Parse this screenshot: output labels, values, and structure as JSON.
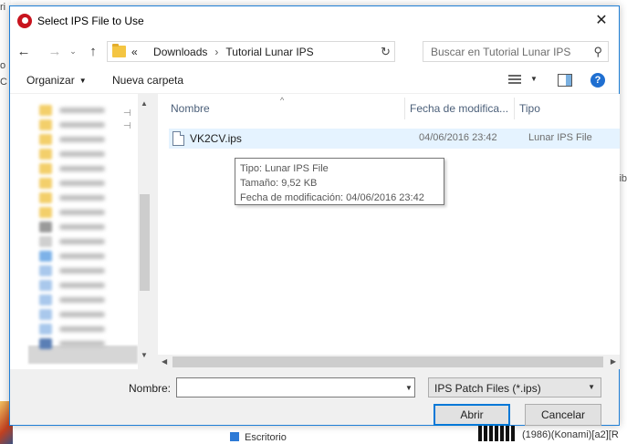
{
  "dialog": {
    "title": "Select IPS File to Use",
    "close_glyph": "✕"
  },
  "nav": {
    "back_glyph": "←",
    "forward_glyph": "→",
    "recent_glyph": "⌄",
    "up_glyph": "↑",
    "breadcrumb_overflow": "«",
    "breadcrumb": [
      "Downloads",
      "Tutorial Lunar IPS"
    ],
    "breadcrumb_separator": "›",
    "dropdown_glyph": "⌄",
    "refresh_glyph": "↻",
    "search_placeholder": "Buscar en Tutorial Lunar IPS",
    "search_glyph": "⚲"
  },
  "toolbar": {
    "organize_label": "Organizar",
    "organize_caret": "▼",
    "new_folder_label": "Nueva carpeta",
    "view_caret": "▼",
    "help_glyph": "?"
  },
  "navpane": {
    "pin_glyph": "⊣",
    "scroll_up": "▲",
    "scroll_down": "▼",
    "item_icon_colors": [
      "#f3cf6b",
      "#f3cf6b",
      "#f3cf6b",
      "#f3cf6b",
      "#f3cf6b",
      "#f3cf6b",
      "#f3cf6b",
      "#f3cf6b",
      "#9a9a9a",
      "#cfcfcf",
      "#7db2e8",
      "#a9c8ec",
      "#a9c8ec",
      "#a9c8ec",
      "#a9c8ec",
      "#a9c8ec",
      "#5a7fb5"
    ]
  },
  "filelist": {
    "columns": {
      "name": "Nombre",
      "date": "Fecha de modifica...",
      "type": "Tipo"
    },
    "sort_glyph": "^",
    "files": [
      {
        "name": "VK2CV.ips",
        "date": "04/06/2016 23:42",
        "type": "Lunar IPS File"
      }
    ],
    "tooltip": {
      "type": "Tipo: Lunar IPS File",
      "size": "Tamaño: 9,52 KB",
      "modified": "Fecha de modificación: 04/06/2016 23:42"
    },
    "hscroll_left": "◀",
    "hscroll_right": "▶"
  },
  "bottom": {
    "name_label": "Nombre:",
    "name_value": "",
    "name_drop": "▼",
    "filter_value": "IPS Patch Files (*.ips)",
    "filter_caret": "▼",
    "open_label": "Abrir",
    "cancel_label": "Cancelar"
  },
  "background": {
    "left_fragments": [
      "ri",
      "o",
      "C"
    ],
    "right_fragment": "ib",
    "escritorio": "Escritorio",
    "bottom_right": "(1986)(Konami)[a2][R"
  }
}
